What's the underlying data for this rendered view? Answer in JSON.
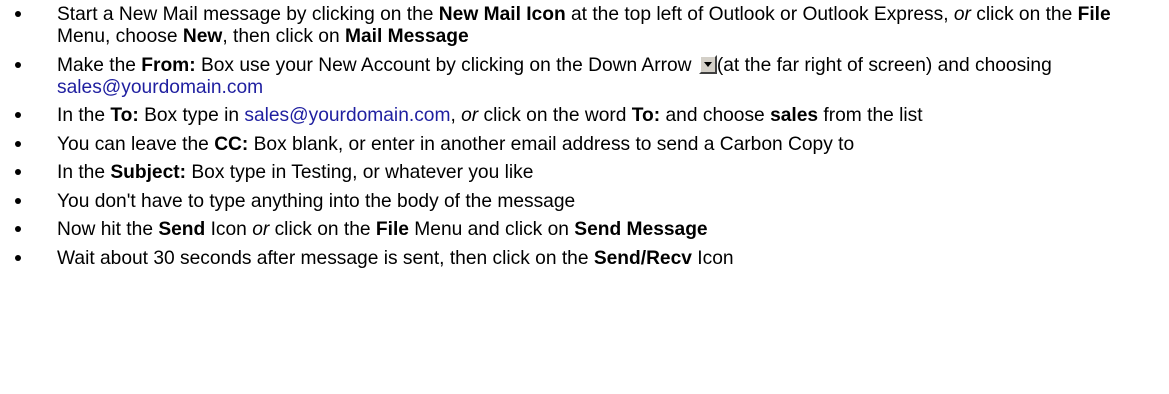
{
  "steps": [
    {
      "segments": [
        {
          "t": "Start a New Mail message by clicking on the ",
          "s": "n"
        },
        {
          "t": "New Mail Icon",
          "s": "b"
        },
        {
          "t": " at the top left of Outlook or Outlook Express, ",
          "s": "n"
        },
        {
          "t": "or",
          "s": "i"
        },
        {
          "t": " click on the ",
          "s": "n"
        },
        {
          "t": "File",
          "s": "b"
        },
        {
          "t": " Menu, choose ",
          "s": "n"
        },
        {
          "t": "New",
          "s": "b"
        },
        {
          "t": ", then click on ",
          "s": "n"
        },
        {
          "t": "Mail Message",
          "s": "b"
        }
      ]
    },
    {
      "segments": [
        {
          "t": "Make the ",
          "s": "n"
        },
        {
          "t": "From:",
          "s": "b"
        },
        {
          "t": " Box use your New Account by clicking on the Down Arrow ",
          "s": "n"
        },
        {
          "t": "",
          "s": "dropdown"
        },
        {
          "t": "(at the far right of screen) and choosing ",
          "s": "n"
        },
        {
          "t": "sales@yourdomain.com",
          "s": "link"
        }
      ]
    },
    {
      "segments": [
        {
          "t": "In the ",
          "s": "n"
        },
        {
          "t": "To:",
          "s": "b"
        },
        {
          "t": " Box type in ",
          "s": "n"
        },
        {
          "t": "sales@yourdomain.com",
          "s": "link"
        },
        {
          "t": ", ",
          "s": "n"
        },
        {
          "t": "or",
          "s": "i"
        },
        {
          "t": " click on the word ",
          "s": "n"
        },
        {
          "t": "To:",
          "s": "b"
        },
        {
          "t": " and choose ",
          "s": "n"
        },
        {
          "t": "sales",
          "s": "b"
        },
        {
          "t": " from the list",
          "s": "n"
        }
      ]
    },
    {
      "segments": [
        {
          "t": "You can leave the ",
          "s": "n"
        },
        {
          "t": "CC:",
          "s": "b"
        },
        {
          "t": " Box blank, or enter in another email address to send a Carbon Copy to",
          "s": "n"
        }
      ]
    },
    {
      "segments": [
        {
          "t": "In the ",
          "s": "n"
        },
        {
          "t": "Subject:",
          "s": "b"
        },
        {
          "t": " Box type in Testing, or whatever you like",
          "s": "n"
        }
      ]
    },
    {
      "segments": [
        {
          "t": "You don't have to type anything into the body of the message",
          "s": "n"
        }
      ]
    },
    {
      "segments": [
        {
          "t": "Now hit the ",
          "s": "n"
        },
        {
          "t": "Send",
          "s": "b"
        },
        {
          "t": " Icon ",
          "s": "n"
        },
        {
          "t": "or",
          "s": "i"
        },
        {
          "t": " click on the ",
          "s": "n"
        },
        {
          "t": "File",
          "s": "b"
        },
        {
          "t": " Menu and click on ",
          "s": "n"
        },
        {
          "t": "Send Message",
          "s": "b"
        }
      ]
    },
    {
      "segments": [
        {
          "t": "Wait about 30 seconds after message is sent, then click on the ",
          "s": "n"
        },
        {
          "t": "Send/Recv",
          "s": "b"
        },
        {
          "t": " Icon",
          "s": "n"
        }
      ]
    }
  ],
  "icons": {
    "dropdown": "down-arrow-button-icon"
  }
}
